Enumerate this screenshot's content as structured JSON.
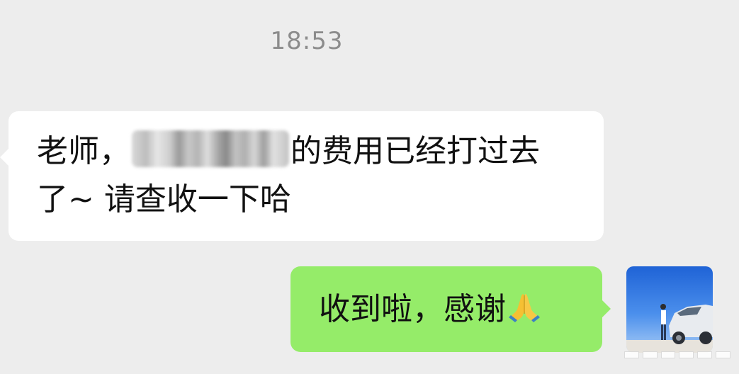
{
  "chat": {
    "timestamp": "18:53",
    "incoming": {
      "text_before_redaction": "老师，",
      "text_after_redaction": "的费用已经打过去",
      "text_line2": "了~ 请查收一下哈"
    },
    "outgoing": {
      "text": "收到啦，感谢",
      "emoji": "folded-hands-emoji"
    },
    "avatar": "user-avatar-photo"
  },
  "colors": {
    "background": "#ededed",
    "incoming_bubble": "#ffffff",
    "outgoing_bubble": "#95ec69",
    "timestamp": "#8c8c8c"
  }
}
